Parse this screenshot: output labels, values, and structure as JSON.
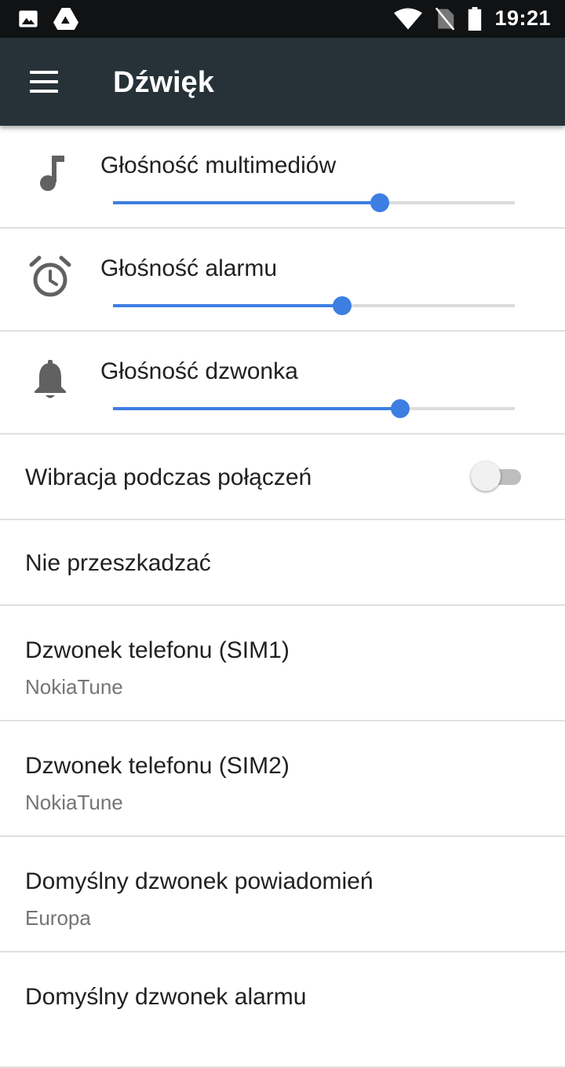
{
  "status_bar": {
    "time": "19:21",
    "icons": [
      "image-icon",
      "drive-icon",
      "wifi-icon",
      "no-sim-icon",
      "battery-icon"
    ]
  },
  "app_bar": {
    "title": "Dźwięk",
    "menu_icon": "hamburger-menu-icon"
  },
  "volumes": [
    {
      "label": "Głośność multimediów",
      "icon": "music-note-icon",
      "level": 0.665
    },
    {
      "label": "Głośność alarmu",
      "icon": "alarm-clock-icon",
      "level": 0.57
    },
    {
      "label": "Głośność dzwonka",
      "icon": "bell-icon",
      "level": 0.715
    }
  ],
  "vibration": {
    "label": "Wibracja podczas połączeń",
    "enabled": false
  },
  "do_not_disturb": {
    "label": "Nie przeszkadzać"
  },
  "ringtones": [
    {
      "title": "Dzwonek telefonu (SIM1)",
      "value": "NokiaTune"
    },
    {
      "title": "Dzwonek telefonu (SIM2)",
      "value": "NokiaTune"
    },
    {
      "title": "Domyślny dzwonek powiadomień",
      "value": "Europa"
    },
    {
      "title": "Domyślny dzwonek alarmu",
      "value": ""
    }
  ],
  "colors": {
    "accent": "#3d7ee2",
    "app_bar": "#263238",
    "status_bar": "#101214",
    "icon_gray": "#616161"
  }
}
